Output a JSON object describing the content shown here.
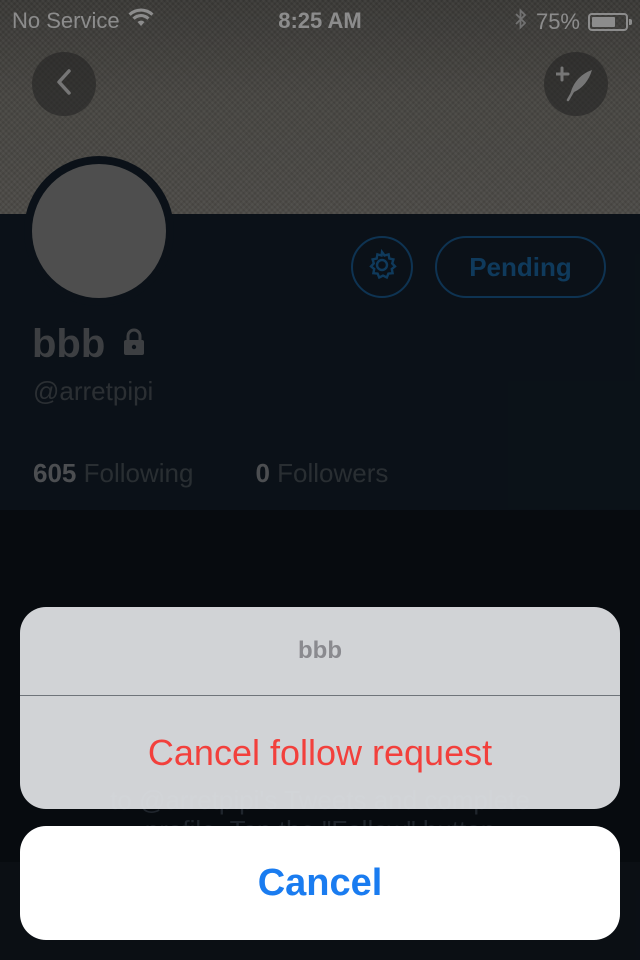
{
  "status_bar": {
    "carrier": "No Service",
    "time": "8:25 AM",
    "battery": "75%",
    "battery_level": 0.75
  },
  "header": {
    "back_icon": "chevron-left-icon",
    "compose_icon": "compose-feather-icon"
  },
  "profile": {
    "name": "bbb",
    "lock_icon": "lock-icon",
    "handle": "@arretpipi",
    "pending_label": "Pending",
    "settings_icon": "gear-icon",
    "following_count": "605",
    "following_label": "Following",
    "followers_count": "0",
    "followers_label": "Followers"
  },
  "background_text": {
    "line1": "to @arretpipi's Tweets and complete",
    "line2": "profile. Tap the \"Follow\" button"
  },
  "action_sheet": {
    "title": "bbb",
    "action_label": "Cancel follow request",
    "cancel_label": "Cancel"
  },
  "colors": {
    "accent": "#1c6aa8",
    "destructive": "#f2403c",
    "cancel_blue": "#1a7cf0"
  }
}
